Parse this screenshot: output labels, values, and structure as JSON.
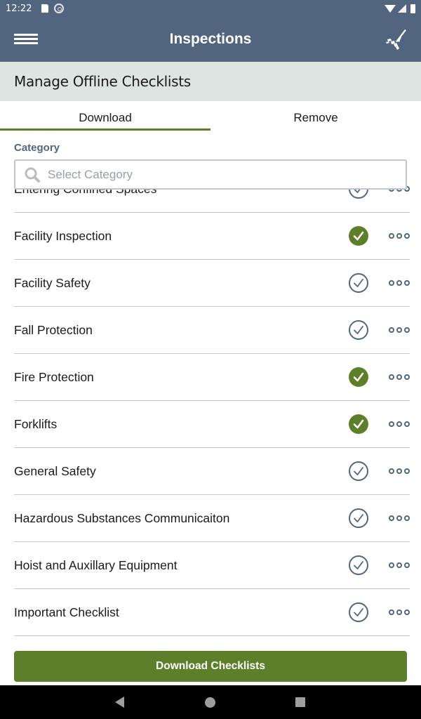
{
  "status_bar": {
    "time": "12:22",
    "icons": [
      "sd-card-icon",
      "sync-icon",
      "wifi-icon",
      "signal-icon",
      "battery-icon"
    ]
  },
  "app_bar": {
    "title": "Inspections",
    "left_icon": "hamburger-menu-icon",
    "right_icon": "checklist-logo-icon"
  },
  "section": {
    "title": "Manage Offline Checklists"
  },
  "tabs": [
    {
      "label": "Download",
      "active": true
    },
    {
      "label": "Remove",
      "active": false
    }
  ],
  "filter": {
    "label": "Category",
    "placeholder": "Select Category",
    "value": ""
  },
  "list": {
    "items": [
      {
        "label": "Entering Confined Spaces",
        "downloaded": false,
        "partially_hidden": true
      },
      {
        "label": "Facility Inspection",
        "downloaded": true
      },
      {
        "label": "Facility Safety",
        "downloaded": false
      },
      {
        "label": "Fall Protection",
        "downloaded": false
      },
      {
        "label": "Fire Protection",
        "downloaded": true
      },
      {
        "label": "Forklifts",
        "downloaded": true
      },
      {
        "label": "General Safety",
        "downloaded": false
      },
      {
        "label": "Hazardous Substances Communicaiton",
        "downloaded": false
      },
      {
        "label": "Hoist and Auxillary Equipment",
        "downloaded": false
      },
      {
        "label": "Important Checklist",
        "downloaded": false
      }
    ]
  },
  "footer": {
    "button_label": "Download Checklists"
  },
  "colors": {
    "header": "#52657f",
    "accent_green": "#5e7f2a",
    "section_bg": "#dde5e3"
  }
}
